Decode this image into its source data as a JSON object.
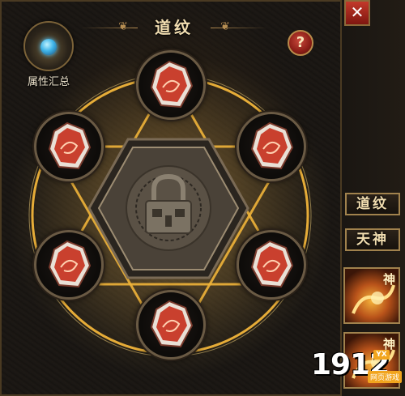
{
  "window": {
    "title": "道纹",
    "close_glyph": "✕",
    "help_glyph": "?"
  },
  "summary": {
    "label": "属性汇总",
    "icon": "dragon-orb-icon"
  },
  "center": {
    "icon": "padlock-icon",
    "state": "locked"
  },
  "slots": [
    {
      "id": "top",
      "icon": "rune-crystal-icon"
    },
    {
      "id": "upper-left",
      "icon": "rune-crystal-icon"
    },
    {
      "id": "upper-right",
      "icon": "rune-crystal-icon"
    },
    {
      "id": "lower-left",
      "icon": "rune-crystal-icon"
    },
    {
      "id": "lower-right",
      "icon": "rune-crystal-icon"
    },
    {
      "id": "bottom",
      "icon": "rune-crystal-icon"
    }
  ],
  "side_tabs": [
    {
      "label": "道纹"
    },
    {
      "label": "天神"
    }
  ],
  "god_cards": [
    {
      "label": "神"
    },
    {
      "label": "神"
    }
  ],
  "watermark": {
    "number": "1912",
    "badge": "YX",
    "subtitle": "网页游戏"
  },
  "colors": {
    "gold": "#f0b43a",
    "frame": "#a1824d",
    "close_red": "#c2392a",
    "rune_red": "#c9402e"
  }
}
